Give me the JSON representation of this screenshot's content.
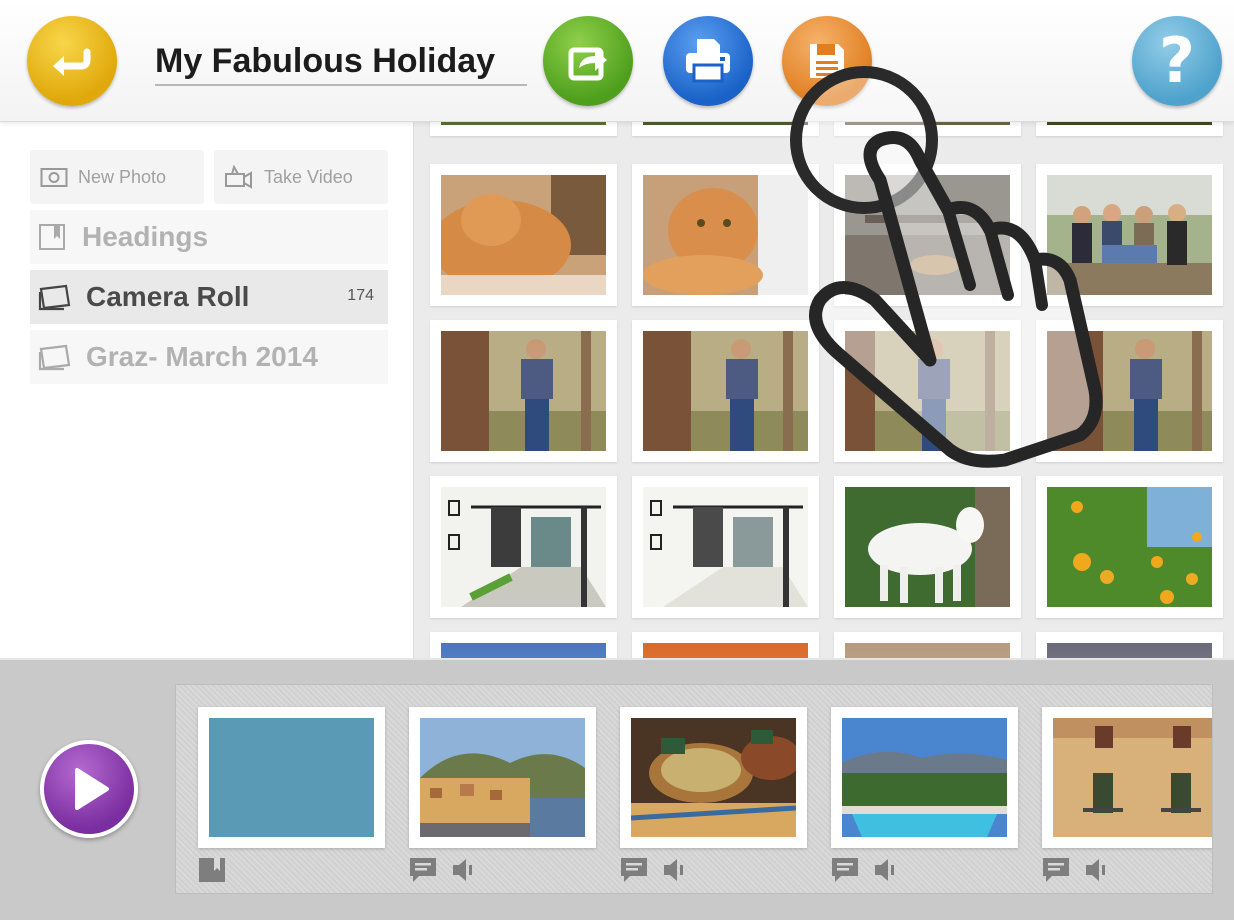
{
  "toolbar": {
    "title": "My Fabulous Holiday",
    "back_icon": "back-arrow-icon",
    "share_icon": "share-icon",
    "print_icon": "print-icon",
    "save_icon": "save-icon",
    "help_label": "?"
  },
  "sidebar": {
    "new_photo": "New Photo",
    "take_video": "Take Video",
    "headings": "Headings",
    "camera_roll": "Camera Roll",
    "camera_roll_count": "174",
    "album": "Graz- March 2014"
  },
  "colors": {
    "back": "#e8b21a",
    "share": "#5cb128",
    "print": "#2a73d6",
    "save": "#eb8c32",
    "help": "#5ab0d8",
    "play": "#8a3bb0",
    "blank_slide": "#5b9ab5"
  },
  "grid": {
    "photos": [
      "cat-photo",
      "cat-photo",
      "bench-photo",
      "group-photo",
      "woman-tree-photo",
      "woman-tree-photo",
      "woman-tree-photo",
      "woman-tree-photo",
      "sketch-photo",
      "sketch-photo",
      "goat-photo",
      "lemon-tree-photo"
    ]
  },
  "timeline": {
    "play_icon": "play-icon",
    "slides": [
      "blank-slide",
      "coast-town-photo",
      "food-market-photo",
      "pool-photo",
      "building-photo"
    ]
  }
}
